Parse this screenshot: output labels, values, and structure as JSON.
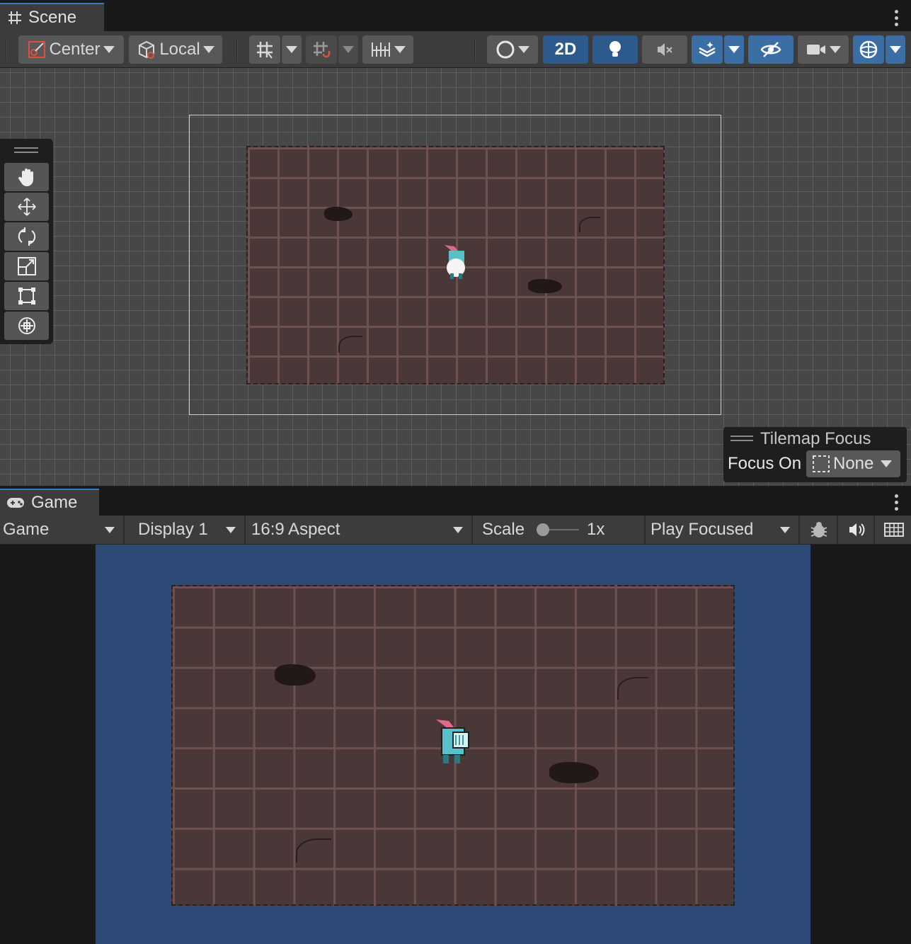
{
  "scene_panel": {
    "tab_label": "Scene",
    "toolbar": {
      "pivot_mode": "Center",
      "pivot_rotation": "Local",
      "toggle_2d": "2D"
    },
    "tools": [
      "hand-tool",
      "move-tool",
      "rotate-tool",
      "scale-tool",
      "rect-tool",
      "transform-tool"
    ],
    "tilemap_focus": {
      "title": "Tilemap Focus",
      "focus_label": "Focus On",
      "focus_value": "None"
    }
  },
  "game_panel": {
    "tab_label": "Game",
    "toolbar": {
      "view_mode": "Game",
      "display": "Display 1",
      "aspect": "16:9 Aspect",
      "scale_label": "Scale",
      "scale_value": "1x",
      "play_mode": "Play Focused"
    },
    "background_color": "#2e4b78"
  },
  "colors": {
    "accent": "#3a78c4",
    "floor": "#4a3838",
    "floor_lines": "#6d5050",
    "scene_bg": "#474747"
  }
}
